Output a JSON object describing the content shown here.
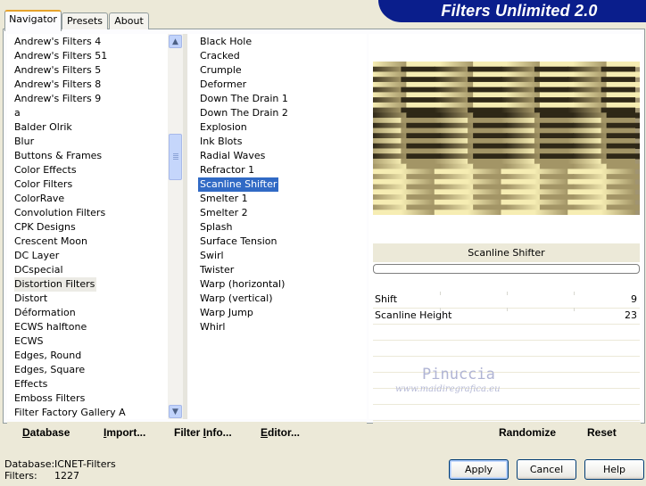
{
  "header": {
    "title": "Filters Unlimited 2.0"
  },
  "tabs": [
    {
      "label": "Navigator",
      "active": true
    },
    {
      "label": "Presets",
      "active": false
    },
    {
      "label": "About",
      "active": false
    }
  ],
  "categories": {
    "items": [
      "Andrew's Filters 4",
      "Andrew's Filters 51",
      "Andrew's Filters 5",
      "Andrew's Filters 8",
      "Andrew's Filters 9",
      "a",
      "Balder Olrik",
      "Blur",
      "Buttons & Frames",
      "Color Effects",
      "Color Filters",
      "ColorRave",
      "Convolution Filters",
      "CPK Designs",
      "Crescent Moon",
      "DC Layer",
      "DCspecial",
      "Distortion Filters",
      "Distort",
      "Déformation",
      "ECWS halftone",
      "ECWS",
      "Edges, Round",
      "Edges, Square",
      "Effects",
      "Emboss Filters",
      "Filter Factory Gallery A"
    ],
    "selected_index": 17
  },
  "filters": {
    "items": [
      "Black Hole",
      "Cracked",
      "Crumple",
      "Deformer",
      "Down The Drain 1",
      "Down The Drain 2",
      "Explosion",
      "Ink Blots",
      "Radial Waves",
      "Refractor 1",
      "Scanline Shifter",
      "Smelter 1",
      "Smelter 2",
      "Splash",
      "Surface Tension",
      "Swirl",
      "Twister",
      "Warp (horizontal)",
      "Warp (vertical)",
      "Warp Jump",
      "Whirl"
    ],
    "selected_index": 10
  },
  "preview": {
    "filter_name": "Scanline Shifter",
    "colors": {
      "light": "#f6edb3",
      "dark": "#2f2817",
      "mid": "#a39566"
    }
  },
  "params": [
    {
      "label": "Shift",
      "value": "9"
    },
    {
      "label": "Scanline Height",
      "value": "23"
    }
  ],
  "watermark": {
    "name": "Pinuccia",
    "site": "www.maidiregrafica.eu"
  },
  "actions": {
    "database": {
      "first": "D",
      "rest": "atabase"
    },
    "import": {
      "first": "I",
      "rest": "mport..."
    },
    "filter_info": {
      "first": "Filter ",
      "u": "I",
      "rest": "nfo..."
    },
    "editor": {
      "first": "E",
      "rest": "ditor..."
    },
    "randomize": "Randomize",
    "reset": "Reset"
  },
  "status": {
    "database_label": "Database:",
    "database_value": "ICNET-Filters",
    "filters_label": "Filters:",
    "filters_value": "1227"
  },
  "buttons": {
    "apply": "Apply",
    "cancel": "Cancel",
    "help": "Help"
  },
  "accent": "#316ac5"
}
